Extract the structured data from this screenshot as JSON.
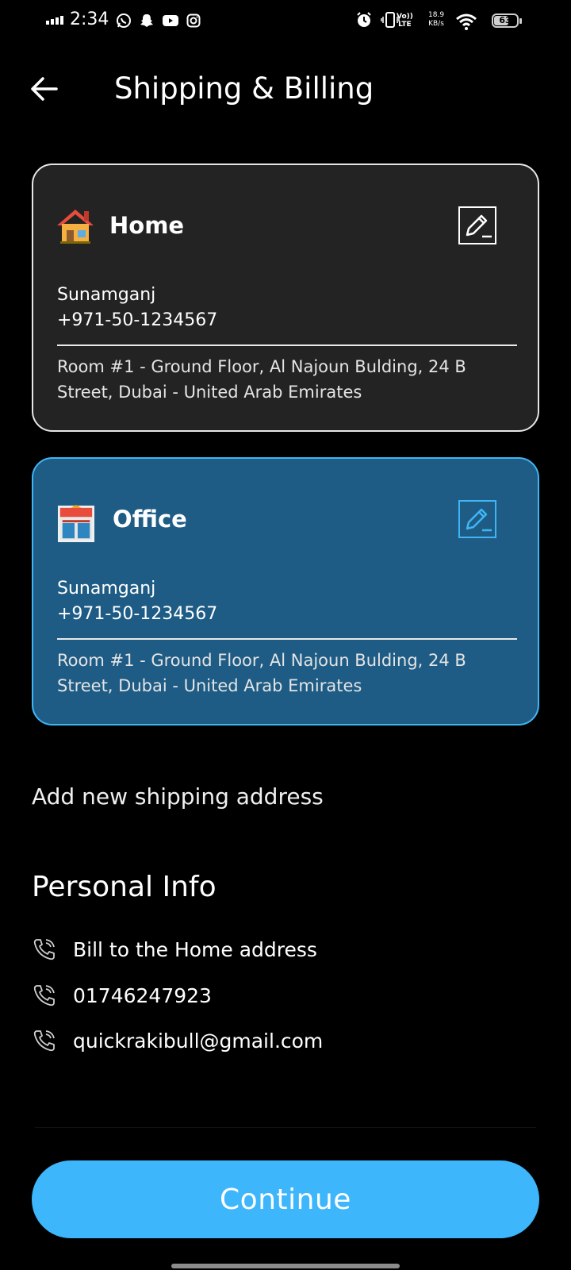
{
  "status_bar": {
    "time": "2:34",
    "battery": "63",
    "battery_level": 0.63,
    "network_speed_value": "18.9",
    "network_speed_unit": "KB/s",
    "volte_label": "Vo))\nLTE",
    "icons_left": [
      "whatsapp-icon",
      "snapchat-icon",
      "youtube-icon",
      "instagram-icon"
    ],
    "icons_right": [
      "alarm-icon",
      "vibrate-icon",
      "volte-icon",
      "wifi-icon",
      "battery-icon"
    ]
  },
  "header": {
    "title": "Shipping & Billing",
    "back_icon": "arrow-left-icon"
  },
  "addresses": [
    {
      "label": "Home",
      "icon": "house-icon",
      "name": "Sunamganj",
      "phone": "+971-50-1234567",
      "address": "Room #1 - Ground Floor, Al Najoun Bulding, 24 B Street, Dubai - United Arab Emirates",
      "selected": false
    },
    {
      "label": "Office",
      "icon": "store-icon",
      "name": "Sunamganj",
      "phone": "+971-50-1234567",
      "address": "Room #1 - Ground Floor, Al Najoun Bulding, 24 B Street, Dubai - United Arab Emirates",
      "selected": true
    }
  ],
  "add_address_label": "Add new shipping address",
  "personal_info": {
    "title": "Personal Info",
    "items": [
      {
        "icon": "phone-icon",
        "text": "Bill to the Home address"
      },
      {
        "icon": "phone-icon",
        "text": "01746247923"
      },
      {
        "icon": "phone-icon",
        "text": "quickrakibull@gmail.com"
      }
    ]
  },
  "continue_label": "Continue",
  "colors": {
    "background": "#000000",
    "card": "#232323",
    "card_selected": "#1e5c85",
    "accent": "#3db6fb"
  }
}
